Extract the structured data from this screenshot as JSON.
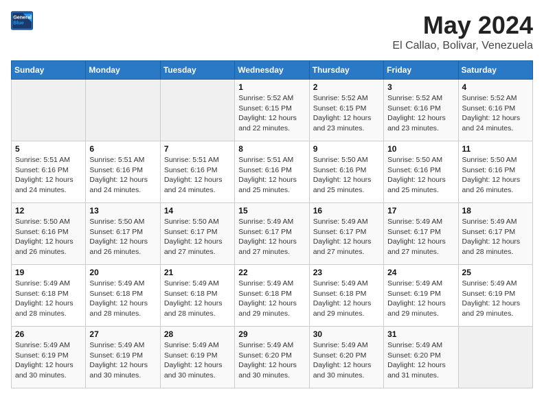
{
  "logo": {
    "line1": "General",
    "line2": "Blue"
  },
  "title": "May 2024",
  "subtitle": "El Callao, Bolivar, Venezuela",
  "days_of_week": [
    "Sunday",
    "Monday",
    "Tuesday",
    "Wednesday",
    "Thursday",
    "Friday",
    "Saturday"
  ],
  "weeks": [
    [
      {
        "day": "",
        "info": ""
      },
      {
        "day": "",
        "info": ""
      },
      {
        "day": "",
        "info": ""
      },
      {
        "day": "1",
        "info": "Sunrise: 5:52 AM\nSunset: 6:15 PM\nDaylight: 12 hours\nand 22 minutes."
      },
      {
        "day": "2",
        "info": "Sunrise: 5:52 AM\nSunset: 6:15 PM\nDaylight: 12 hours\nand 23 minutes."
      },
      {
        "day": "3",
        "info": "Sunrise: 5:52 AM\nSunset: 6:16 PM\nDaylight: 12 hours\nand 23 minutes."
      },
      {
        "day": "4",
        "info": "Sunrise: 5:52 AM\nSunset: 6:16 PM\nDaylight: 12 hours\nand 24 minutes."
      }
    ],
    [
      {
        "day": "5",
        "info": "Sunrise: 5:51 AM\nSunset: 6:16 PM\nDaylight: 12 hours\nand 24 minutes."
      },
      {
        "day": "6",
        "info": "Sunrise: 5:51 AM\nSunset: 6:16 PM\nDaylight: 12 hours\nand 24 minutes."
      },
      {
        "day": "7",
        "info": "Sunrise: 5:51 AM\nSunset: 6:16 PM\nDaylight: 12 hours\nand 24 minutes."
      },
      {
        "day": "8",
        "info": "Sunrise: 5:51 AM\nSunset: 6:16 PM\nDaylight: 12 hours\nand 25 minutes."
      },
      {
        "day": "9",
        "info": "Sunrise: 5:50 AM\nSunset: 6:16 PM\nDaylight: 12 hours\nand 25 minutes."
      },
      {
        "day": "10",
        "info": "Sunrise: 5:50 AM\nSunset: 6:16 PM\nDaylight: 12 hours\nand 25 minutes."
      },
      {
        "day": "11",
        "info": "Sunrise: 5:50 AM\nSunset: 6:16 PM\nDaylight: 12 hours\nand 26 minutes."
      }
    ],
    [
      {
        "day": "12",
        "info": "Sunrise: 5:50 AM\nSunset: 6:16 PM\nDaylight: 12 hours\nand 26 minutes."
      },
      {
        "day": "13",
        "info": "Sunrise: 5:50 AM\nSunset: 6:17 PM\nDaylight: 12 hours\nand 26 minutes."
      },
      {
        "day": "14",
        "info": "Sunrise: 5:50 AM\nSunset: 6:17 PM\nDaylight: 12 hours\nand 27 minutes."
      },
      {
        "day": "15",
        "info": "Sunrise: 5:49 AM\nSunset: 6:17 PM\nDaylight: 12 hours\nand 27 minutes."
      },
      {
        "day": "16",
        "info": "Sunrise: 5:49 AM\nSunset: 6:17 PM\nDaylight: 12 hours\nand 27 minutes."
      },
      {
        "day": "17",
        "info": "Sunrise: 5:49 AM\nSunset: 6:17 PM\nDaylight: 12 hours\nand 27 minutes."
      },
      {
        "day": "18",
        "info": "Sunrise: 5:49 AM\nSunset: 6:17 PM\nDaylight: 12 hours\nand 28 minutes."
      }
    ],
    [
      {
        "day": "19",
        "info": "Sunrise: 5:49 AM\nSunset: 6:18 PM\nDaylight: 12 hours\nand 28 minutes."
      },
      {
        "day": "20",
        "info": "Sunrise: 5:49 AM\nSunset: 6:18 PM\nDaylight: 12 hours\nand 28 minutes."
      },
      {
        "day": "21",
        "info": "Sunrise: 5:49 AM\nSunset: 6:18 PM\nDaylight: 12 hours\nand 28 minutes."
      },
      {
        "day": "22",
        "info": "Sunrise: 5:49 AM\nSunset: 6:18 PM\nDaylight: 12 hours\nand 29 minutes."
      },
      {
        "day": "23",
        "info": "Sunrise: 5:49 AM\nSunset: 6:18 PM\nDaylight: 12 hours\nand 29 minutes."
      },
      {
        "day": "24",
        "info": "Sunrise: 5:49 AM\nSunset: 6:19 PM\nDaylight: 12 hours\nand 29 minutes."
      },
      {
        "day": "25",
        "info": "Sunrise: 5:49 AM\nSunset: 6:19 PM\nDaylight: 12 hours\nand 29 minutes."
      }
    ],
    [
      {
        "day": "26",
        "info": "Sunrise: 5:49 AM\nSunset: 6:19 PM\nDaylight: 12 hours\nand 30 minutes."
      },
      {
        "day": "27",
        "info": "Sunrise: 5:49 AM\nSunset: 6:19 PM\nDaylight: 12 hours\nand 30 minutes."
      },
      {
        "day": "28",
        "info": "Sunrise: 5:49 AM\nSunset: 6:19 PM\nDaylight: 12 hours\nand 30 minutes."
      },
      {
        "day": "29",
        "info": "Sunrise: 5:49 AM\nSunset: 6:20 PM\nDaylight: 12 hours\nand 30 minutes."
      },
      {
        "day": "30",
        "info": "Sunrise: 5:49 AM\nSunset: 6:20 PM\nDaylight: 12 hours\nand 30 minutes."
      },
      {
        "day": "31",
        "info": "Sunrise: 5:49 AM\nSunset: 6:20 PM\nDaylight: 12 hours\nand 31 minutes."
      },
      {
        "day": "",
        "info": ""
      }
    ]
  ]
}
